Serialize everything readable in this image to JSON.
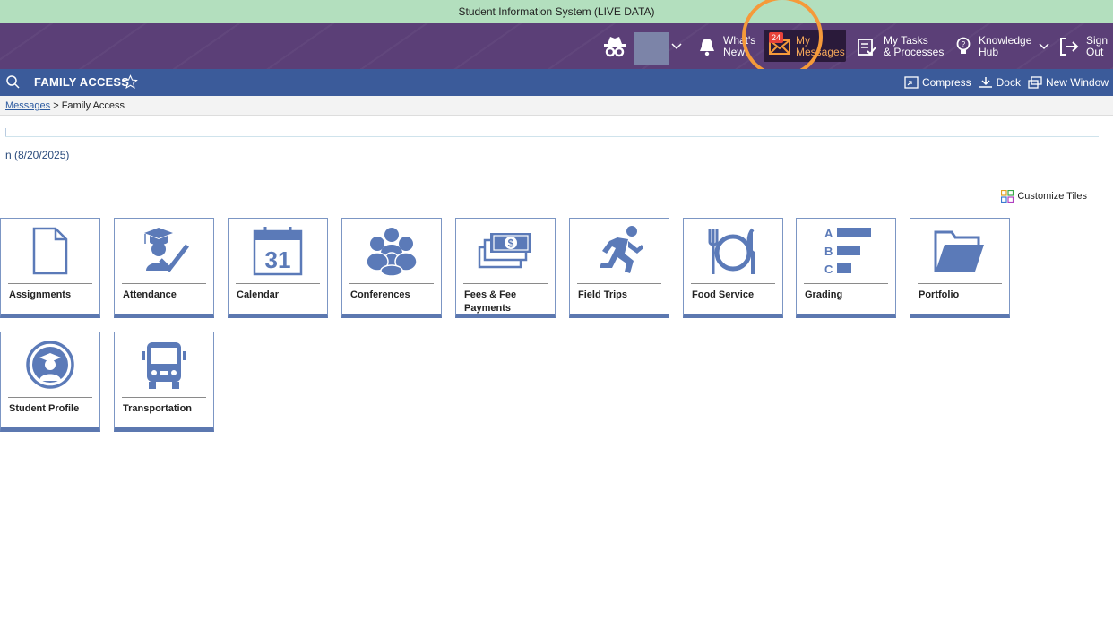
{
  "system_bar": {
    "text": "Student Information System (LIVE DATA)"
  },
  "top_nav": {
    "whats_new": [
      "What's",
      "New"
    ],
    "messages": {
      "line1": "My",
      "line2": "Messages",
      "badge": "24"
    },
    "tasks": [
      "My Tasks",
      "& Processes"
    ],
    "knowledge": [
      "Knowledge",
      "Hub"
    ],
    "signout": [
      "Sign",
      "Out"
    ]
  },
  "sub_bar": {
    "title": "FAMILY ACCESS",
    "compress": "Compress",
    "dock": "Dock",
    "new_window": "New Window"
  },
  "breadcrumb": {
    "link": "Messages",
    "separator": ">",
    "current": "Family Access"
  },
  "date_text": "n (8/20/2025)",
  "customize_tiles": "Customize Tiles",
  "tiles": [
    {
      "label": "Assignments",
      "icon": "document-icon"
    },
    {
      "label": "Attendance",
      "icon": "graduate-check-icon"
    },
    {
      "label": "Calendar",
      "icon": "calendar-icon",
      "day": "31"
    },
    {
      "label": "Conferences",
      "icon": "group-icon"
    },
    {
      "label": "Fees & Fee Payments",
      "icon": "money-icon",
      "symbol": "$"
    },
    {
      "label": "Field Trips",
      "icon": "runner-icon"
    },
    {
      "label": "Food Service",
      "icon": "plate-icon"
    },
    {
      "label": "Grading",
      "icon": "grades-icon",
      "letters": [
        "A",
        "B",
        "C"
      ]
    },
    {
      "label": "Portfolio",
      "icon": "folder-icon"
    },
    {
      "label": "Student Profile",
      "icon": "student-icon"
    },
    {
      "label": "Transportation",
      "icon": "bus-icon"
    }
  ],
  "colors": {
    "accent": "#5b7ab8",
    "nav": "#5b3f77",
    "subbar": "#3b5b9a",
    "highlight": "#f59a3a"
  }
}
